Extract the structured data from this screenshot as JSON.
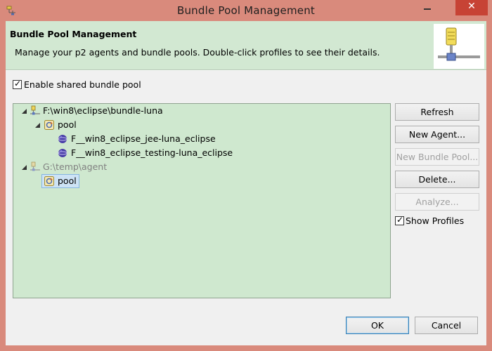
{
  "window": {
    "title": "Bundle Pool Management"
  },
  "banner": {
    "title": "Bundle Pool Management",
    "description": "Manage your p2 agents and bundle pools. Double-click profiles to see their details."
  },
  "options": {
    "enable_shared_pool": {
      "label": "Enable shared bundle pool",
      "checked": true
    },
    "show_profiles": {
      "label": "Show Profiles",
      "checked": true
    }
  },
  "tree": {
    "agents": [
      {
        "label": "F:\\win8\\eclipse\\bundle-luna",
        "expanded": true,
        "pool": {
          "label": "pool",
          "expanded": true,
          "profiles": [
            "F__win8_eclipse_jee-luna_eclipse",
            "F__win8_eclipse_testing-luna_eclipse"
          ]
        }
      },
      {
        "label": "G:\\temp\\agent",
        "expanded": true,
        "pool": {
          "label": "pool",
          "selected": true
        }
      }
    ]
  },
  "buttons": {
    "refresh": "Refresh",
    "new_agent": "New Agent...",
    "new_bundle_pool": "New Bundle Pool...",
    "delete": "Delete...",
    "analyze": "Analyze...",
    "ok": "OK",
    "cancel": "Cancel"
  },
  "colors": {
    "title_bar": "#d98a7c",
    "close_button": "#c74335",
    "banner_bg": "#d2e8d2",
    "tree_bg": "#cfe8cf",
    "selection_border": "#86b6e0"
  },
  "icons": {
    "app": "eclipse-app-icon",
    "banner": "server-database-icon",
    "agent": "agent-tree-icon",
    "pool": "bundle-pool-icon",
    "profile": "profile-sphere-icon"
  }
}
